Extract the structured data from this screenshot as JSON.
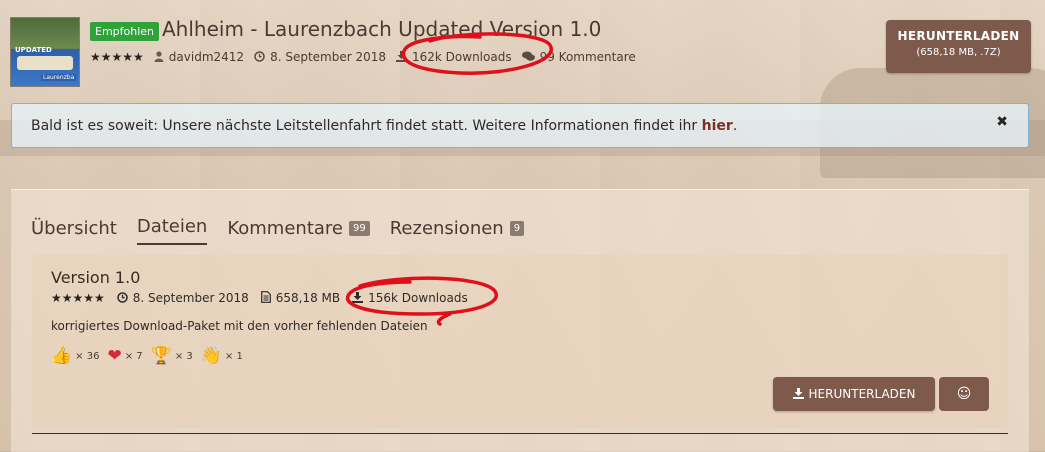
{
  "header": {
    "thumbnail_text": "UPDATED",
    "thumbnail_sub": "Laurenzba",
    "featured_label": "Empfohlen",
    "title": "Ahlheim - Laurenzbach Updated Version 1.0",
    "rating_stars": "★★★★★",
    "author": "davidm2412",
    "date": "8. September 2018",
    "downloads": "162k Downloads",
    "comments": "99 Kommentare",
    "download_button": {
      "label": "HERUNTERLADEN",
      "sub": "(658,18 MB, .7Z)"
    }
  },
  "notice": {
    "text": "Bald ist es soweit: Unsere nächste Leitstellenfahrt findet statt. Weitere Informationen findet ihr ",
    "link": "hier",
    "suffix": ".",
    "close": "✖"
  },
  "tabs": [
    {
      "label": "Übersicht"
    },
    {
      "label": "Dateien",
      "active": true
    },
    {
      "label": "Kommentare",
      "badge": "99"
    },
    {
      "label": "Rezensionen",
      "badge": "9"
    }
  ],
  "file": {
    "version": "Version 1.0",
    "stars": "★★★★★",
    "date": "8. September 2018",
    "size": "658,18 MB",
    "downloads": "156k Downloads",
    "description": "korrigiertes Download-Paket mit den vorher fehlenden Dateien",
    "reactions": [
      {
        "icon": "thumbs-up",
        "emoji": "👍",
        "count": "× 36"
      },
      {
        "icon": "heart",
        "emoji": "❤",
        "count": "× 7"
      },
      {
        "icon": "trophy",
        "emoji": "🏆",
        "count": "× 3"
      },
      {
        "icon": "clapping-hand",
        "emoji": "👋",
        "count": "× 1"
      }
    ],
    "download_button": "HERUNTERLADEN",
    "react_button": "☺"
  },
  "colors": {
    "brown_button": "#7d5a4c",
    "featured_green": "#2fa23a",
    "annotation_red": "#e0101a",
    "notice_border": "#7fb0d6"
  }
}
